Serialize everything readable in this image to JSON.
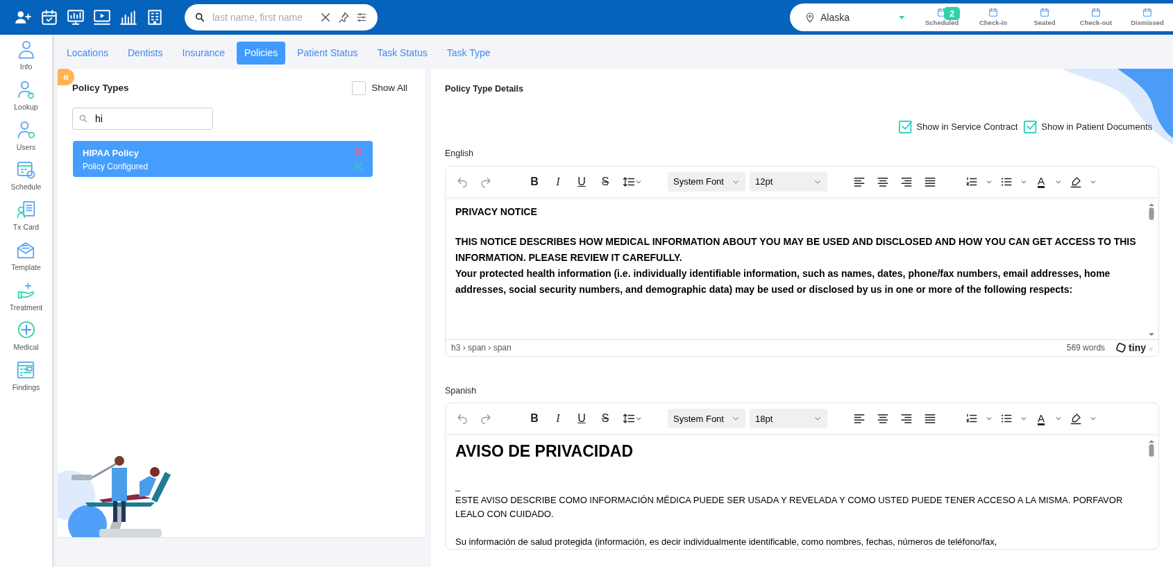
{
  "top_bar": {
    "search": {
      "placeholder": "last name, first name"
    },
    "location": "Alaska",
    "statuses": [
      {
        "label": "Scheduled",
        "badge": "2"
      },
      {
        "label": "Check-in"
      },
      {
        "label": "Seated"
      },
      {
        "label": "Check-out"
      },
      {
        "label": "Dismissed"
      }
    ]
  },
  "sidebar": {
    "items": [
      {
        "label": "Info"
      },
      {
        "label": "Lookup"
      },
      {
        "label": "Users"
      },
      {
        "label": "Schedule"
      },
      {
        "label": "Tx Card"
      },
      {
        "label": "Template"
      },
      {
        "label": "Treatment"
      },
      {
        "label": "Medical"
      },
      {
        "label": "Findings"
      }
    ]
  },
  "tabs": [
    {
      "label": "Locations",
      "selected": false
    },
    {
      "label": "Dentists",
      "selected": false
    },
    {
      "label": "Insurance",
      "selected": false
    },
    {
      "label": "Policies",
      "selected": true
    },
    {
      "label": "Patient Status",
      "selected": false
    },
    {
      "label": "Task Status",
      "selected": false
    },
    {
      "label": "Task Type",
      "selected": false
    }
  ],
  "policy_types": {
    "collapse_button": "«",
    "title": "Policy Types",
    "show_all": {
      "label": "Show All",
      "checked": false
    },
    "search": {
      "value": "hi"
    },
    "items": [
      {
        "title": "HIPAA Policy",
        "subtitle": "Policy Configured",
        "selected": true
      }
    ]
  },
  "details": {
    "title": "Policy Type Details",
    "options": [
      {
        "label": "Show in Service Contract",
        "checked": true
      },
      {
        "label": "Show in Patient Documents",
        "checked": true
      }
    ],
    "editors": [
      {
        "language": "English",
        "format_buttons": [
          "B",
          "I",
          "U",
          "S"
        ],
        "text_color_glyph": "A",
        "font": "System Font",
        "size": "12pt",
        "content": [
          {
            "kind": "bold",
            "text": "PRIVACY NOTICE"
          },
          {
            "kind": "blank"
          },
          {
            "kind": "bold",
            "text": "THIS NOTICE DESCRIBES HOW MEDICAL INFORMATION ABOUT YOU MAY BE USED AND DISCLOSED AND HOW YOU CAN GET ACCESS TO THIS INFORMATION. PLEASE REVIEW IT CAREFULLY."
          },
          {
            "kind": "bold",
            "text": "Your protected health information (i.e. individually identifiable information, such as names, dates, phone/fax numbers, email addresses, home addresses, social security numbers, and demographic data) may be used or disclosed by us in one or more of the following respects:"
          }
        ],
        "path": "h3 › span › span",
        "word_count": "569 words",
        "brand": "tiny"
      },
      {
        "language": "Spanish",
        "format_buttons": [
          "B",
          "I",
          "U",
          "S"
        ],
        "text_color_glyph": "A",
        "font": "System Font",
        "size": "18pt",
        "content": [
          {
            "kind": "heading",
            "text": "AVISO DE PRIVACIDAD"
          },
          {
            "kind": "blank"
          },
          {
            "kind": "plain",
            "text": "_"
          },
          {
            "kind": "plain",
            "text": "ESTE AVISO DESCRIBE COMO INFORMACIÓN MÉDICA PUEDE SER USADA Y REVELADA Y COMO USTED PUEDE TENER ACCESO A LA MISMA. PORFAVOR LEALO CON CUIDADO."
          },
          {
            "kind": "blank"
          },
          {
            "kind": "plain",
            "text": "Su información de salud protegida (información, es decir individualmente identificable, como nombres, fechas, números de teléfono/fax,"
          }
        ]
      }
    ]
  }
}
